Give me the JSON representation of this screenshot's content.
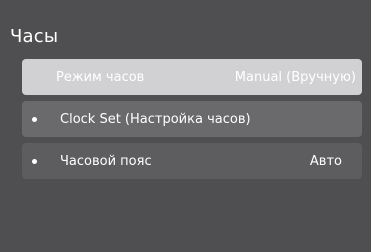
{
  "panel": {
    "title": "Часы"
  },
  "menu": {
    "items": [
      {
        "label": "Режим часов",
        "value": "Manual (Вручную)",
        "selected": true,
        "bullet": false
      },
      {
        "label": "Clock Set (Настройка часов)",
        "value": "",
        "selected": false,
        "bullet": true
      },
      {
        "label": "Часовой пояс",
        "value": "Авто",
        "selected": false,
        "bullet": true
      }
    ]
  },
  "colors": {
    "background": "#4f4f51",
    "selected_item": "#d1d1d3",
    "item": "#6a6a6c",
    "faded_item": "#5d5d60",
    "text": "#ffffff"
  }
}
